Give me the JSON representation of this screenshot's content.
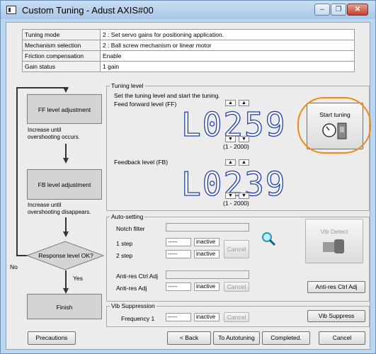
{
  "window": {
    "title": "Custom Tuning - Adust AXIS#00",
    "minimize_glyph": "–",
    "maximize_glyph": "❐",
    "close_glyph": "✕"
  },
  "info": [
    {
      "key": "Tuning mode",
      "value": "2 : Set servo gains for positioning application."
    },
    {
      "key": "Mechanism selection",
      "value": "2 : Ball screw mechanism or linear motor"
    },
    {
      "key": "Friction compensation",
      "value": "Enable"
    },
    {
      "key": "Gain status",
      "value": "1 gain"
    }
  ],
  "flow": {
    "ff_box": "FF level adjustment",
    "ff_hint": "Increase until\novershooting occurs.",
    "fb_box": "FB level adjustment",
    "fb_hint": "Increase until\novershooting disappears.",
    "decision": "Response level OK?",
    "no_label": "No",
    "yes_label": "Yes",
    "finish": "Finish"
  },
  "tuning_level": {
    "legend": "Tuning level",
    "instruction": "Set the tuning level and start the tuning.",
    "ff_label": "Feed forward level (FF)",
    "ff_value": "L0259",
    "ff_range": "(1 - 2000)",
    "fb_label": "Feedback level (FB)",
    "fb_value": "L0239",
    "fb_range": "(1 - 2000)",
    "start_tuning": "Start tuning"
  },
  "auto_setting": {
    "legend": "Auto-setting",
    "notch_filter": "Notch filter",
    "step1": "1 step",
    "step1_value": "-----",
    "step1_status": "inactive",
    "step2": "2 step",
    "step2_value": "-----",
    "step2_status": "inactive",
    "cancel": "Cancel",
    "antires_ctrl": "Anti-res Ctrl Adj",
    "antires_adj": "Anti-res Adj",
    "antires_value": "-----",
    "antires_status": "inactive",
    "antires_cancel": "Cancel",
    "vib_detect": "Vib Detect",
    "antires_ctrl_btn": "Anti-res Ctrl Adj"
  },
  "vib_suppression": {
    "legend": "Vib Suppression",
    "freq_label": "Frequency 1",
    "freq_value": "-----",
    "freq_status": "inactive",
    "cancel": "Cancel",
    "vib_suppress_btn": "Vib Suppress"
  },
  "footer": {
    "precautions": "Precautions",
    "back": "< Back",
    "to_autotuning": "To Autotuning",
    "completed": "Completed.",
    "cancel": "Cancel"
  },
  "colors": {
    "lcd_digits": "#1d3ea8",
    "highlight": "#f08a17",
    "title_bar": "#bcd6ee"
  }
}
